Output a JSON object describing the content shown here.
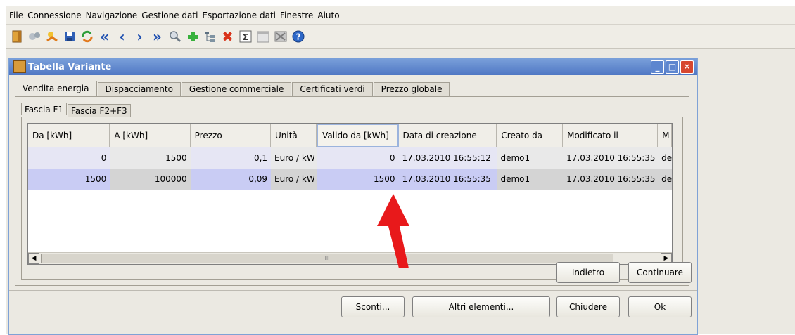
{
  "menu": [
    "File",
    "Connessione",
    "Navigazione",
    "Gestione dati",
    "Esportazione dati",
    "Finestre",
    "Aiuto"
  ],
  "toolbar_icons": [
    "exit-icon",
    "connect-icon",
    "disconnect-icon",
    "save-icon",
    "refresh-icon",
    "first-icon",
    "previous-icon",
    "next-icon",
    "last-icon",
    "search-icon",
    "add-icon",
    "tree-icon",
    "delete-icon",
    "sum-icon",
    "calendar-icon",
    "export-icon",
    "help-icon"
  ],
  "window": {
    "title": "Tabella Variante"
  },
  "tabs": [
    "Vendita energia",
    "Dispacciamento",
    "Gestione commerciale",
    "Certificati verdi",
    "Prezzo globale"
  ],
  "subtabs": [
    "Fascia F1",
    "Fascia F2+F3"
  ],
  "table": {
    "columns": [
      "Da [kWh]",
      "A [kWh]",
      "Prezzo",
      "Unità",
      "Valido da [kWh]",
      "Data di creazione",
      "Creato da",
      "Modificato il",
      "M"
    ],
    "rows": [
      [
        "0",
        "1500",
        "0,1",
        "Euro / kW",
        "0",
        "17.03.2010 16:55:12",
        "demo1",
        "17.03.2010 16:55:35",
        "de"
      ],
      [
        "1500",
        "100000",
        "0,09",
        "Euro / kW",
        "1500",
        "17.03.2010 16:55:35",
        "demo1",
        "17.03.2010 16:55:35",
        "de"
      ]
    ],
    "scroll_grip": "III"
  },
  "buttons": {
    "back": "Indietro",
    "continue": "Continuare",
    "discounts": "Sconti...",
    "other": "Altri elementi...",
    "close": "Chiudere",
    "ok": "Ok"
  },
  "colors": {
    "title_bar": "#5b84cc",
    "selected_row": "#c9ccf4",
    "annotation_arrow": "#e8191b"
  }
}
